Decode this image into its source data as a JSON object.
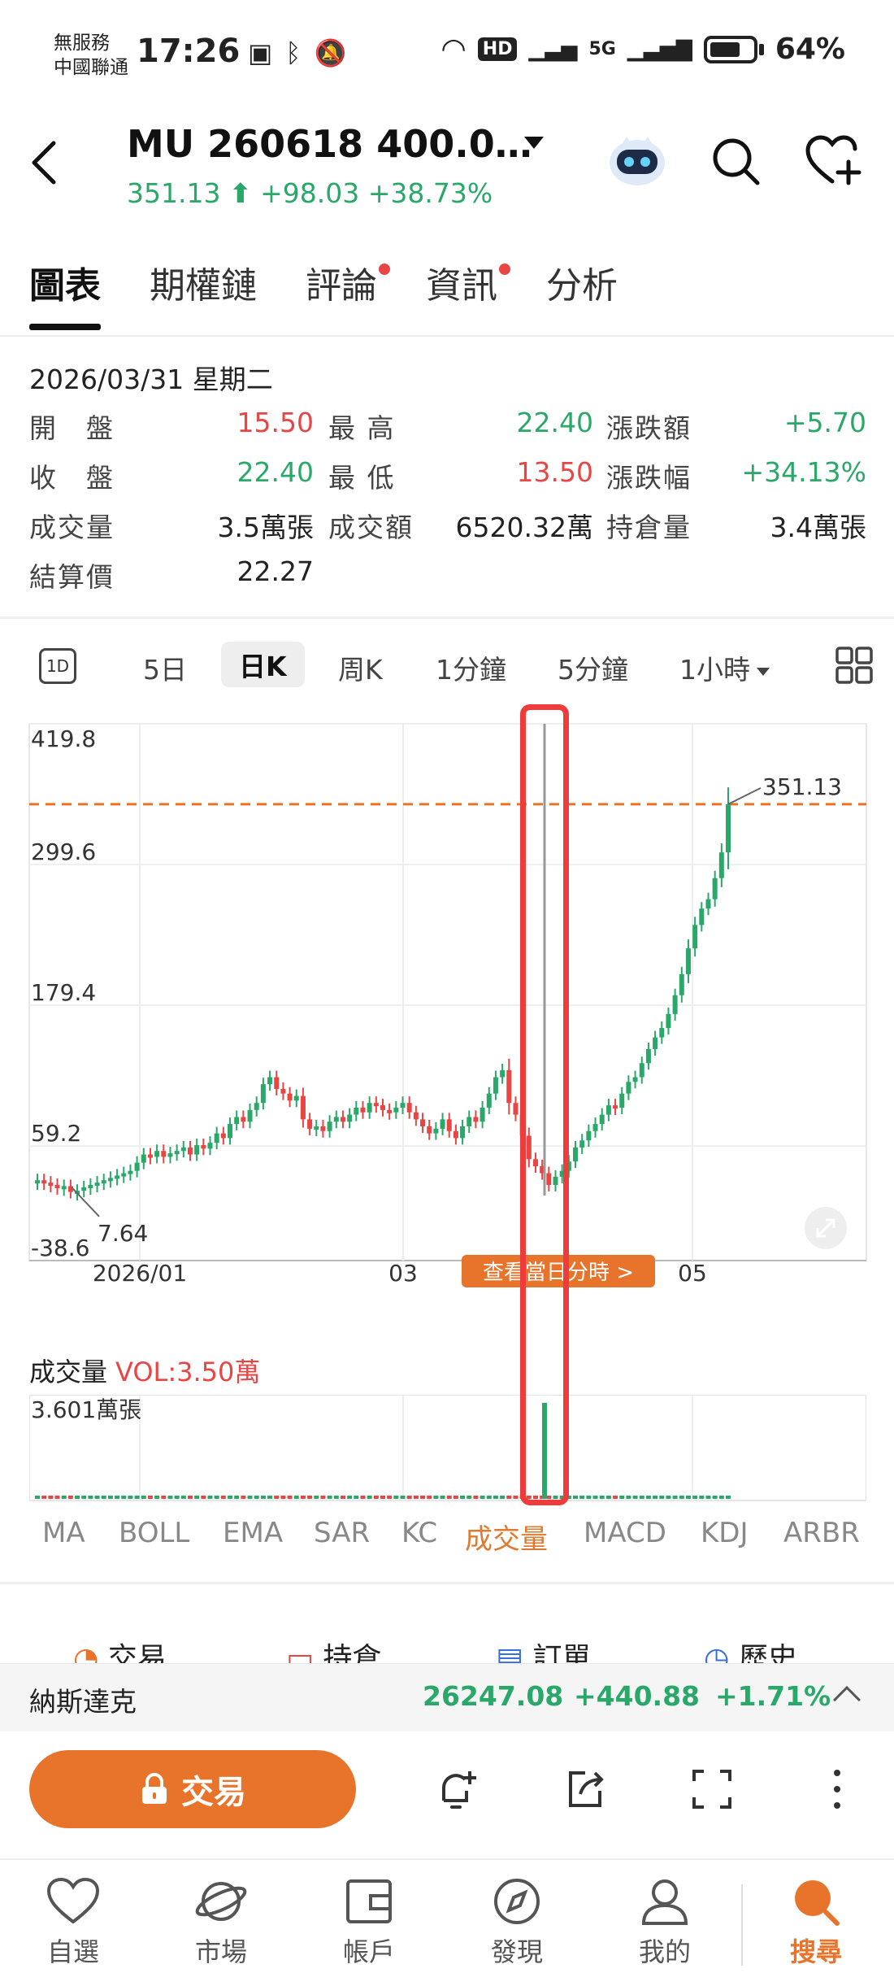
{
  "status_bar": {
    "carrier_line1": "無服務",
    "carrier_line2": "中國聯通",
    "time": "17:26",
    "network": "5G",
    "hd_label": "HD",
    "battery": "64%"
  },
  "header": {
    "title": "MU 260618 400.0…",
    "last_price": "351.13",
    "change": "+98.03",
    "change_pct": "+38.73%"
  },
  "tabs": [
    {
      "label": "圖表",
      "active": true,
      "dot": false
    },
    {
      "label": "期權鏈",
      "active": false,
      "dot": false
    },
    {
      "label": "評論",
      "active": false,
      "dot": true
    },
    {
      "label": "資訊",
      "active": false,
      "dot": true
    },
    {
      "label": "分析",
      "active": false,
      "dot": false
    }
  ],
  "quote": {
    "date": "2026/03/31 星期二",
    "rows": [
      [
        {
          "label": "開　盤",
          "value": "15.50",
          "tone": "up"
        },
        {
          "label": "最 高",
          "value": "22.40",
          "tone": "dn"
        },
        {
          "label": "漲跌額",
          "value": "+5.70",
          "tone": "dn"
        }
      ],
      [
        {
          "label": "收　盤",
          "value": "22.40",
          "tone": "dn"
        },
        {
          "label": "最 低",
          "value": "13.50",
          "tone": "up"
        },
        {
          "label": "漲跌幅",
          "value": "+34.13%",
          "tone": "dn"
        }
      ],
      [
        {
          "label": "成交量",
          "value": "3.5萬張",
          "tone": "neutral"
        },
        {
          "label": "成交額",
          "value": "6520.32萬",
          "tone": "neutral"
        },
        {
          "label": "持倉量",
          "value": "3.4萬張",
          "tone": "neutral"
        }
      ],
      [
        {
          "label": "結算價",
          "value": "22.27",
          "tone": "neutral"
        }
      ]
    ]
  },
  "periods": {
    "one_day": "1D",
    "items": [
      {
        "label": "5日",
        "active": false
      },
      {
        "label": "日K",
        "active": true
      },
      {
        "label": "周K",
        "active": false
      },
      {
        "label": "1分鐘",
        "active": false
      },
      {
        "label": "5分鐘",
        "active": false
      },
      {
        "label": "1小時",
        "active": false
      }
    ]
  },
  "chart_data": {
    "type": "line",
    "title": "",
    "y_ticks": [
      "419.8",
      "299.6",
      "179.4",
      "59.2",
      "-38.6"
    ],
    "ylim": [
      -38.6,
      419.8
    ],
    "x_ticks": [
      "2026/01",
      "03",
      "05"
    ],
    "last_price_line": 351.13,
    "last_price_label": "351.13",
    "low_label": "7.64",
    "series": [
      {
        "values": [
          30,
          28,
          26,
          24,
          25,
          20,
          21,
          24,
          26,
          28,
          30,
          32,
          34,
          36,
          38,
          45,
          52,
          50,
          55,
          50,
          53,
          55,
          58,
          52,
          60,
          57,
          62,
          70,
          66,
          78,
          84,
          80,
          90,
          96,
          112,
          118,
          108,
          104,
          98,
          102,
          82,
          74,
          76,
          72,
          80,
          84,
          80,
          86,
          92,
          88,
          96,
          94,
          90,
          88,
          92,
          96,
          88,
          82,
          76,
          70,
          74,
          82,
          72,
          66,
          76,
          84,
          80,
          92,
          104,
          118,
          124,
          96,
          86,
          68,
          48,
          42,
          36,
          26,
          33,
          38,
          46,
          58,
          64,
          72,
          78,
          86,
          94,
          92,
          104,
          114,
          118,
          130,
          142,
          152,
          160,
          172,
          188,
          206,
          228,
          248,
          262,
          270,
          288,
          310,
          351.13
        ]
      }
    ],
    "volume": {
      "label": "成交量",
      "vol_text": "VOL:3.50萬",
      "max_label": "3.601萬張",
      "spike_value": 3.601
    },
    "highlight_note": "查看當日分時 >"
  },
  "indicators": [
    {
      "label": "MA",
      "active": false
    },
    {
      "label": "BOLL",
      "active": false
    },
    {
      "label": "EMA",
      "active": false
    },
    {
      "label": "SAR",
      "active": false
    },
    {
      "label": "KC",
      "active": false
    },
    {
      "label": "成交量",
      "active": true
    },
    {
      "label": "MACD",
      "active": false
    },
    {
      "label": "KDJ",
      "active": false
    },
    {
      "label": "ARBR",
      "active": false
    }
  ],
  "trade_row": [
    "交易",
    "持倉",
    "訂單",
    "歷史"
  ],
  "index_bar": {
    "name": "納斯達克",
    "value": "26247.08",
    "change": "+440.88",
    "change_pct": "+1.71%"
  },
  "actions": {
    "trade_button": "交易"
  },
  "nav": [
    {
      "label": "自選",
      "active": false
    },
    {
      "label": "市場",
      "active": false
    },
    {
      "label": "帳戶",
      "active": false
    },
    {
      "label": "發現",
      "active": false
    },
    {
      "label": "我的",
      "active": false
    },
    {
      "label": "搜尋",
      "active": true
    }
  ],
  "colors": {
    "up": "#e84545",
    "down": "#2aa86a",
    "accent": "#e8742c",
    "highlight_box": "#ee3b3b"
  }
}
